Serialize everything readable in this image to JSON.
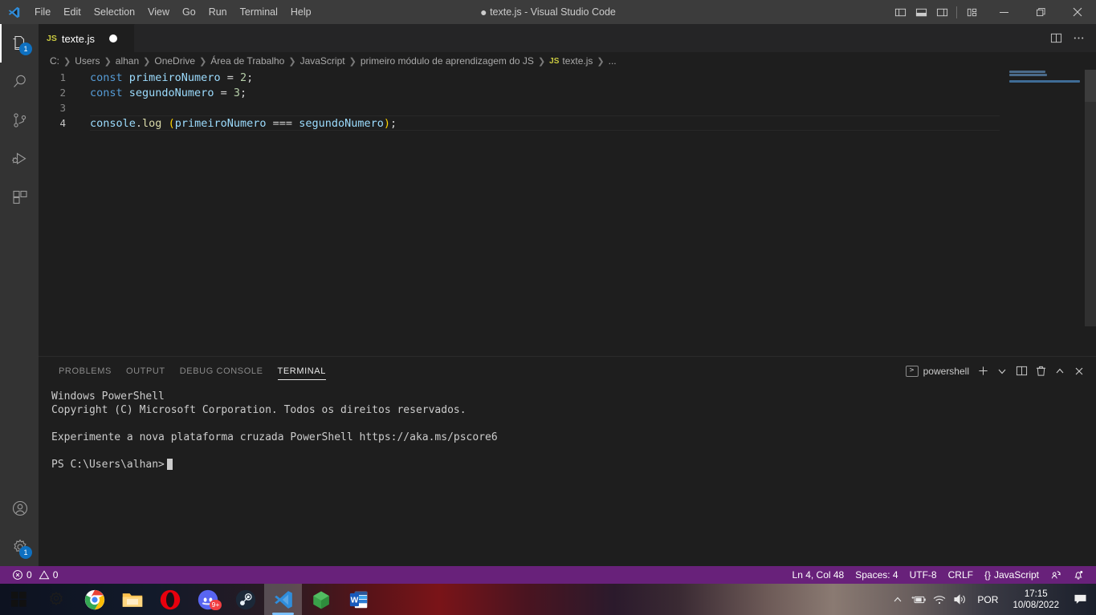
{
  "titlebar": {
    "logo_icon": "vscode-logo-icon",
    "menus": [
      "File",
      "Edit",
      "Selection",
      "View",
      "Go",
      "Run",
      "Terminal",
      "Help"
    ],
    "window_title": "texte.js - Visual Studio Code",
    "dirty_marker": "●",
    "layout_icons": [
      "panel-left-icon",
      "panel-bottom-icon",
      "panel-right-icon",
      "customize-layout-icon"
    ],
    "window_controls": {
      "minimize": "minimize-icon",
      "maximize": "maximize-icon",
      "close": "close-icon"
    }
  },
  "activitybar": {
    "items": [
      {
        "name": "explorer",
        "icon": "files-icon",
        "badge": "1",
        "active": true
      },
      {
        "name": "search",
        "icon": "search-icon",
        "badge": "",
        "active": false
      },
      {
        "name": "source-control",
        "icon": "source-control-icon",
        "badge": "",
        "active": false
      },
      {
        "name": "run-and-debug",
        "icon": "run-debug-icon",
        "badge": "",
        "active": false
      },
      {
        "name": "extensions",
        "icon": "extensions-icon",
        "badge": "",
        "active": false
      }
    ],
    "bottom": [
      {
        "name": "accounts",
        "icon": "account-icon",
        "badge": ""
      },
      {
        "name": "manage",
        "icon": "gear-icon",
        "badge": "1"
      }
    ]
  },
  "editor": {
    "tab": {
      "file_type": "JS",
      "filename": "texte.js",
      "dirty": true
    },
    "tab_actions": [
      "split-editor-icon",
      "more-actions-icon"
    ],
    "breadcrumb": [
      "C:",
      "Users",
      "alhan",
      "OneDrive",
      "Área de Trabalho",
      "JavaScript",
      "primeiro módulo de aprendizagem do JS",
      "texte.js",
      "..."
    ],
    "breadcrumb_file_badge": "JS",
    "code_lines": [
      {
        "number": "1",
        "tokens": [
          {
            "t": "const",
            "c": "kw"
          },
          {
            "t": " ",
            "c": "op"
          },
          {
            "t": "primeiroNumero",
            "c": "var"
          },
          {
            "t": " ",
            "c": "op"
          },
          {
            "t": "=",
            "c": "op"
          },
          {
            "t": " ",
            "c": "op"
          },
          {
            "t": "2",
            "c": "num"
          },
          {
            "t": ";",
            "c": "op"
          }
        ]
      },
      {
        "number": "2",
        "tokens": [
          {
            "t": "const",
            "c": "kw"
          },
          {
            "t": " ",
            "c": "op"
          },
          {
            "t": "segundoNumero",
            "c": "var"
          },
          {
            "t": " ",
            "c": "op"
          },
          {
            "t": "=",
            "c": "op"
          },
          {
            "t": " ",
            "c": "op"
          },
          {
            "t": "3",
            "c": "num"
          },
          {
            "t": ";",
            "c": "op"
          }
        ]
      },
      {
        "number": "3",
        "tokens": []
      },
      {
        "number": "4",
        "current": true,
        "tokens": [
          {
            "t": "console",
            "c": "var"
          },
          {
            "t": ".",
            "c": "op"
          },
          {
            "t": "log",
            "c": "fn"
          },
          {
            "t": " ",
            "c": "op"
          },
          {
            "t": "(",
            "c": "paren"
          },
          {
            "t": "primeiroNumero",
            "c": "var"
          },
          {
            "t": " ",
            "c": "op"
          },
          {
            "t": "===",
            "c": "op"
          },
          {
            "t": " ",
            "c": "op"
          },
          {
            "t": "segundoNumero",
            "c": "var"
          },
          {
            "t": ")",
            "c": "paren"
          },
          {
            "t": ";",
            "c": "op"
          }
        ]
      }
    ]
  },
  "panel": {
    "tabs": [
      "PROBLEMS",
      "OUTPUT",
      "DEBUG CONSOLE",
      "TERMINAL"
    ],
    "active_tab": "TERMINAL",
    "terminal_name": "powershell",
    "terminal_icon": ">",
    "actions": [
      "new-terminal-icon",
      "chevron-down-icon",
      "split-terminal-icon",
      "kill-terminal-icon",
      "maximize-panel-icon",
      "close-panel-icon"
    ],
    "terminal_lines": [
      "Windows PowerShell",
      "Copyright (C) Microsoft Corporation. Todos os direitos reservados.",
      "",
      "Experimente a nova plataforma cruzada PowerShell https://aka.ms/pscore6",
      "",
      "PS C:\\Users\\alhan>"
    ]
  },
  "statusbar": {
    "errors_icon": "error-icon",
    "errors": "0",
    "warnings_icon": "warning-icon",
    "warnings": "0",
    "cursor_position": "Ln 4, Col 48",
    "indentation": "Spaces: 4",
    "encoding": "UTF-8",
    "eol": "CRLF",
    "language_icon": "{}",
    "language": "JavaScript",
    "feedback_icon": "feedback-icon",
    "notifications_icon": "bell-icon",
    "background_color": "#68217a"
  },
  "taskbar": {
    "apps": [
      {
        "name": "start",
        "label": "Start",
        "badge": "",
        "active": false
      },
      {
        "name": "settings",
        "label": "Settings",
        "badge": "",
        "active": false
      },
      {
        "name": "chrome",
        "label": "Google Chrome",
        "badge": "",
        "active": false
      },
      {
        "name": "file-explorer",
        "label": "File Explorer",
        "badge": "",
        "active": false
      },
      {
        "name": "opera",
        "label": "Opera",
        "badge": "",
        "active": false
      },
      {
        "name": "discord",
        "label": "Discord",
        "badge": "9+",
        "active": false
      },
      {
        "name": "steam",
        "label": "Steam",
        "badge": "",
        "active": false
      },
      {
        "name": "vscode",
        "label": "Visual Studio Code",
        "badge": "",
        "active": true
      },
      {
        "name": "unity",
        "label": "Unity",
        "badge": "",
        "active": false
      },
      {
        "name": "word",
        "label": "Microsoft Word",
        "badge": "",
        "active": false
      }
    ],
    "tray": {
      "show_hidden_icon": "chevron-up-icon",
      "battery_icon": "battery-charging-icon",
      "network_icon": "wifi-icon",
      "volume_icon": "speaker-icon",
      "language": "POR",
      "time": "17:15",
      "date": "10/08/2022",
      "notification_icon": "action-center-icon"
    }
  }
}
